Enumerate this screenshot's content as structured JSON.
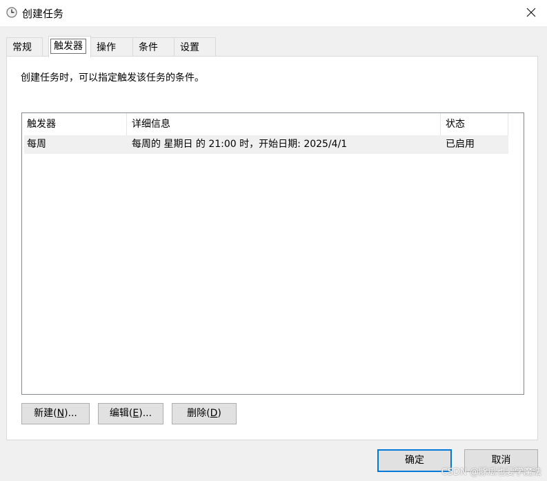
{
  "window": {
    "title": "创建任务",
    "icon": "clock-icon"
  },
  "tabs": [
    {
      "label": "常规"
    },
    {
      "label": "触发器",
      "active": true
    },
    {
      "label": "操作"
    },
    {
      "label": "条件"
    },
    {
      "label": "设置"
    }
  ],
  "panel": {
    "description": "创建任务时，可以指定触发该任务的条件。",
    "columns": [
      "触发器",
      "详细信息",
      "状态"
    ],
    "rows": [
      {
        "trigger": "每周",
        "details": "每周的 星期日 的 21:00 时，开始日期: 2025/4/1",
        "status": "已启用"
      }
    ],
    "buttons": {
      "new": {
        "text": "新建",
        "key": "N"
      },
      "edit": {
        "text": "编辑",
        "key": "E"
      },
      "delete": {
        "text": "删除",
        "key": "D"
      }
    }
  },
  "footer": {
    "ok": "确定",
    "cancel": "取消"
  },
  "watermark": "CSDN @豚瓜也要学魔法"
}
